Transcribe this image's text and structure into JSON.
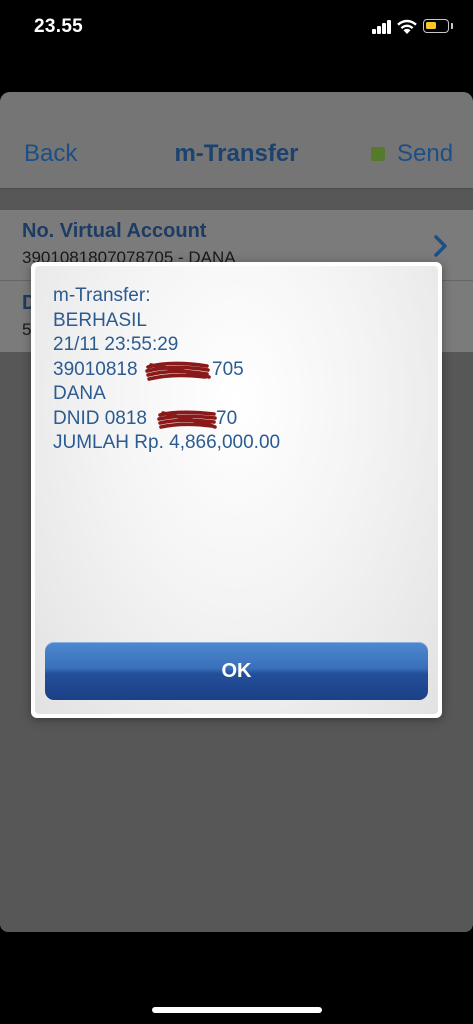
{
  "status_bar": {
    "time": "23.55",
    "icons": [
      "cellular-signal-icon",
      "wifi-icon",
      "battery-icon"
    ],
    "battery_color": "#f3c827"
  },
  "nav": {
    "back_label": "Back",
    "title": "m-Transfer",
    "send_label": "Send",
    "send_indicator_color": "#557a2c"
  },
  "form": {
    "virtual_account_label": "No. Virtual Account",
    "virtual_account_value": "3901081807078705 - DANA",
    "second_row_label": "D",
    "second_row_value": "5"
  },
  "dialog": {
    "lines": [
      "m-Transfer:",
      "BERHASIL",
      "21/11 23:55:29",
      "39010818",
      "705",
      "DANA",
      "DNID 0818",
      "70",
      "JUMLAH Rp. 4,866,000.00"
    ],
    "ok_label": "OK",
    "redaction_color": "#8a1a1a"
  },
  "colors": {
    "accent_blue": "#2c5b92",
    "nav_link_blue": "#1c4f86",
    "button_blue": "#234f9a"
  }
}
